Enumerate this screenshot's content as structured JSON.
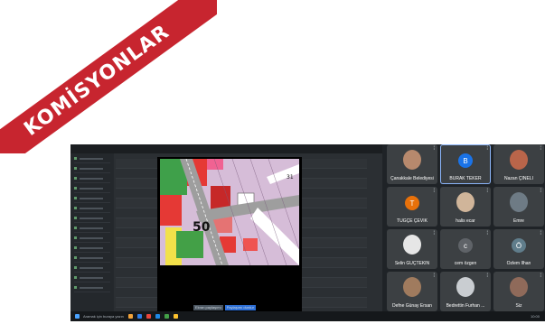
{
  "banner": {
    "text": "KOMİSYONLAR",
    "color": "#c7252f"
  },
  "taskbar": {
    "search_text": "Aramak için buraya yazın",
    "clock": "10:00"
  },
  "map": {
    "label_50": "50",
    "label_31": "31",
    "controls": [
      "Ekran paylaşımı",
      "Paylaşımı durdur"
    ]
  },
  "participants": [
    {
      "name": "Çanakkale Belediyesi",
      "kind": "photo",
      "color": "#b7896d"
    },
    {
      "name": "BURAK TEKER",
      "kind": "initial",
      "initial": "B",
      "color": "#1a73e8",
      "active": true
    },
    {
      "name": "Nazan ÇİNELİ",
      "kind": "photo",
      "color": "#b9654a"
    },
    {
      "name": "TUĞÇE ÇEVİK",
      "kind": "initial",
      "initial": "T",
      "color": "#e8710a"
    },
    {
      "name": "halis ecar",
      "kind": "photo",
      "color": "#d0b59a"
    },
    {
      "name": "Emre",
      "kind": "photo",
      "color": "#6e7b85"
    },
    {
      "name": "Selin GÜÇTEKİN",
      "kind": "photo",
      "color": "#e6e6e6"
    },
    {
      "name": "cem özgen",
      "kind": "initial",
      "initial": "c",
      "color": "#5f6368"
    },
    {
      "name": "Özlem İlhan",
      "kind": "initial",
      "initial": "Ö",
      "color": "#607d8b"
    },
    {
      "name": "Defne Günay Ersan",
      "kind": "photo",
      "color": "#a07b5e"
    },
    {
      "name": "Bedrettin Furhan ...",
      "kind": "photo",
      "color": "#c9cdd1"
    },
    {
      "name": "Siz",
      "kind": "photo",
      "color": "#8f6a5a"
    }
  ]
}
